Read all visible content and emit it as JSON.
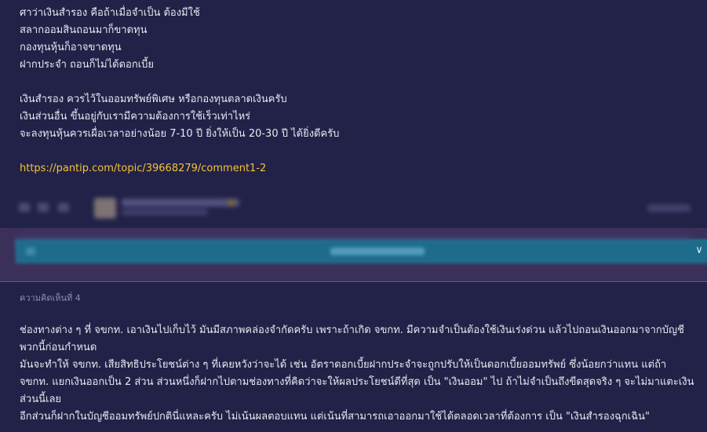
{
  "comment_prev": {
    "lines": [
      "ศาว่าเงินสำรอง คือถ้าเมื่อจำเป็น ต้องมีใช้",
      "สลากออมสินถอนมาก็ขาดทุน",
      "กองทุนหุ้นก็อาจขาดทุน",
      "ฝากประจำ ถอนก็ไม่ได้ดอกเบี้ย",
      "เงินสำรอง ควรไว้ในออมทรัพย์พิเศษ หรือกองทุนตลาดเงินครับ",
      "เงินส่วนอื่น ขึ้นอยู่กับเรามีความต้องการใช้เร็วเท่าไหร่",
      "จะลงทุนหุ้นควรเผื่อเวลาอย่างน้อย 7-10 ปี ยิ่งให้เป็น 20-30 ปี ได้ยิ่งดีครับ"
    ],
    "link": "https://pantip.com/topic/39668279/comment1-2"
  },
  "reply_bar": {
    "edge_icon": "chevron-down-icon",
    "edge_glyph": "∨"
  },
  "comment4": {
    "title": "ความคิดเห็นที่ 4",
    "paragraphs": [
      "ช่องทางต่าง ๆ ที่ จขกท. เอาเงินไปเก็บไว้  มันมีสภาพคล่องจำกัดครับ  เพราะถ้าเกิด จขกท. มีความจำเป็นต้องใช้เงินเร่งด่วน  แล้วไปถอนเงินออกมาจากบัญชีพวกนี้ก่อนกำหนด",
      "มันจะทำให้ จขกท. เสียสิทธิประโยชน์ต่าง ๆ ที่เคยหวังว่าจะได้  เช่น  อัตราดอกเบี้ยฝากประจำจะถูกปรับให้เป็นดอกเบี้ยออมทรัพย์  ซึ่งน้อยกว่าแทน  แต่ถ้า จขกท. แยกเงินออกเป็น 2 ส่วน  ส่วนหนึ่งก็ฝากไปตามช่องทางที่คิดว่าจะให้ผลประโยชน์ดีที่สุด  เป็น \"เงินออม\" ไป  ถ้าไม่จำเป็นถึงขีดสุดจริง ๆ จะไม่มาแตะเงินส่วนนี้เลย",
      "อีกส่วนก็ฝากในบัญชีออมทรัพย์ปกตินี่แหละครับ  ไม่เน้นผลตอบแทน  แต่เน้นที่สามารถเอาออกมาใช้ได้ตลอดเวลาที่ต้องการ  เป็น \"เงินสำรองฉุกเฉิน\""
    ]
  }
}
